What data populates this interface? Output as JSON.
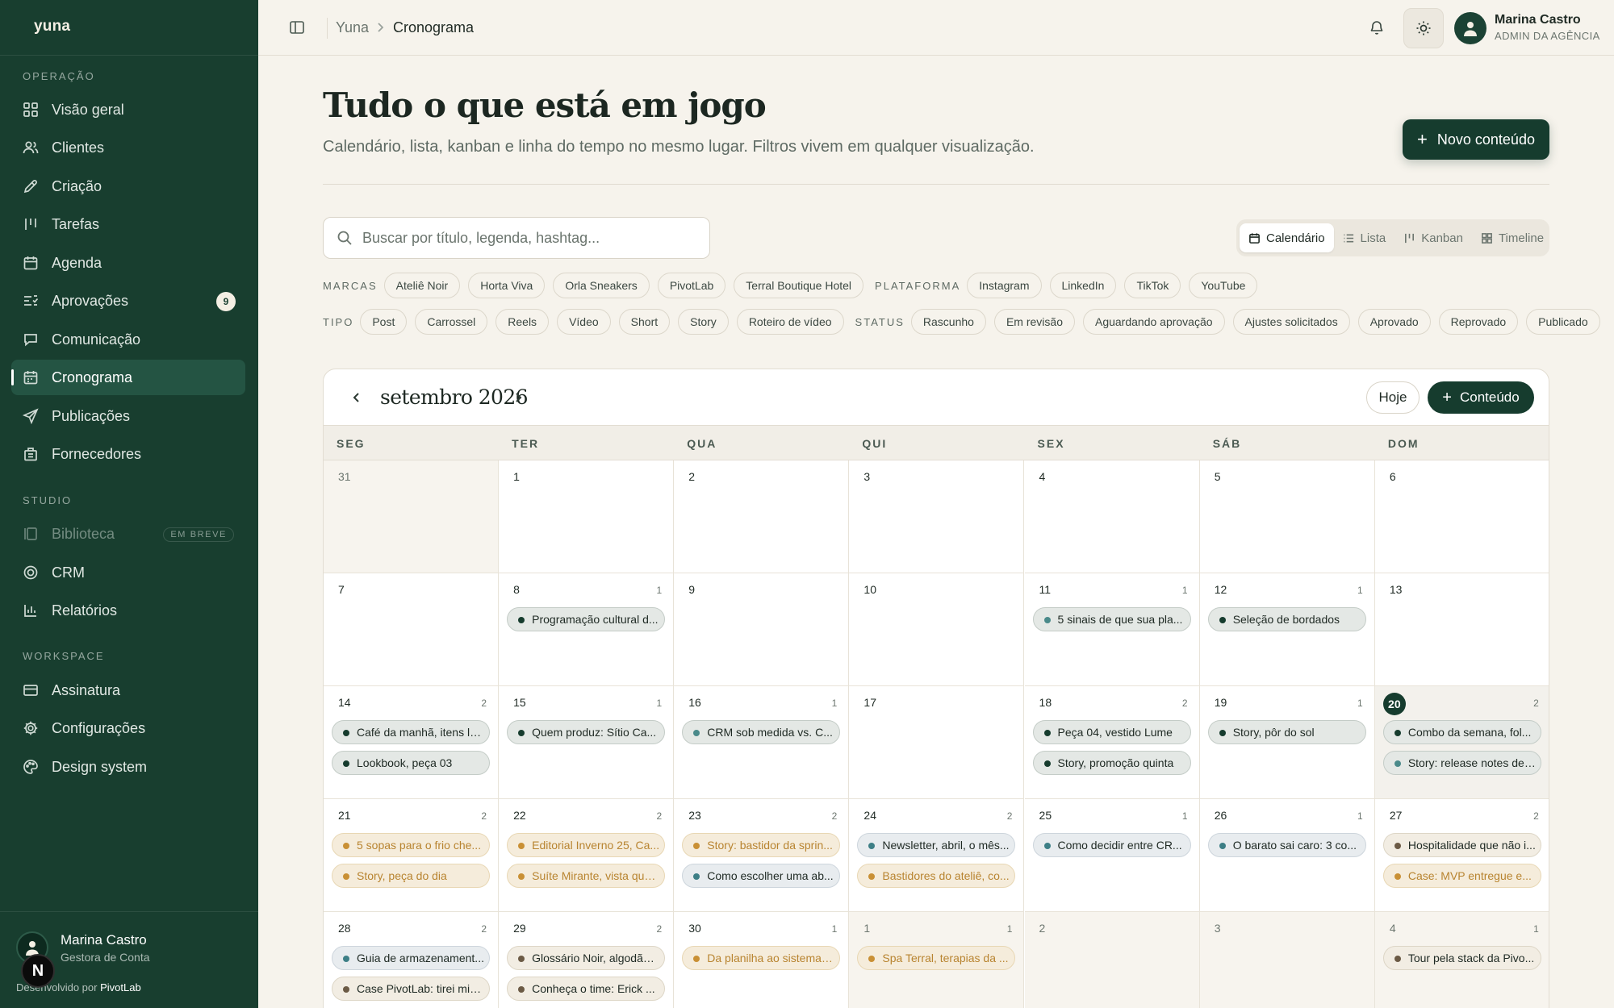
{
  "app": {
    "logo": "yuna"
  },
  "sidebar": {
    "sections": [
      {
        "label": "OPERAÇÃO",
        "items": [
          {
            "label": "Visão geral",
            "icon": "grid-icon"
          },
          {
            "label": "Clientes",
            "icon": "users-icon"
          },
          {
            "label": "Criação",
            "icon": "pen-icon"
          },
          {
            "label": "Tarefas",
            "icon": "kanban-icon"
          },
          {
            "label": "Agenda",
            "icon": "calendar-icon"
          },
          {
            "label": "Aprovações",
            "icon": "list-check-icon",
            "badge": "9"
          },
          {
            "label": "Comunicação",
            "icon": "chat-icon"
          },
          {
            "label": "Cronograma",
            "icon": "calendar-icon",
            "active": true
          },
          {
            "label": "Publicações",
            "icon": "send-icon"
          },
          {
            "label": "Fornecedores",
            "icon": "building-icon"
          }
        ]
      },
      {
        "label": "STUDIO",
        "items": [
          {
            "label": "Biblioteca",
            "icon": "library-icon",
            "soon": "EM BREVE"
          },
          {
            "label": "CRM",
            "icon": "target-icon"
          },
          {
            "label": "Relatórios",
            "icon": "bar-chart-icon"
          }
        ]
      },
      {
        "label": "WORKSPACE",
        "items": [
          {
            "label": "Assinatura",
            "icon": "card-icon"
          },
          {
            "label": "Configurações",
            "icon": "gear-icon"
          },
          {
            "label": "Design system",
            "icon": "palette-icon"
          }
        ]
      }
    ],
    "user": {
      "name": "Marina Castro",
      "role": "Gestora de Conta"
    },
    "credit": {
      "prefix": "Desenvolvido por",
      "brand": "PivotLab"
    },
    "assistant_initial": "N"
  },
  "topbar": {
    "breadcrumb": {
      "root": "Yuna",
      "current": "Cronograma"
    },
    "user": {
      "name": "Marina Castro",
      "role": "ADMIN DA AGÊNCIA"
    }
  },
  "header": {
    "title": "Tudo o que está em jogo",
    "subtitle": "Calendário, lista, kanban e linha do tempo no mesmo lugar. Filtros vivem em qualquer visualização.",
    "new_button": "Novo conteúdo"
  },
  "search": {
    "placeholder": "Buscar por título, legenda, hashtag..."
  },
  "views": [
    {
      "label": "Calendário",
      "icon": "calendar-icon",
      "active": true
    },
    {
      "label": "Lista",
      "icon": "list-icon"
    },
    {
      "label": "Kanban",
      "icon": "kanban-icon"
    },
    {
      "label": "Timeline",
      "icon": "grid-icon"
    }
  ],
  "filters": {
    "marcas": {
      "label": "MARCAS",
      "options": [
        "Ateliê Noir",
        "Horta Viva",
        "Orla Sneakers",
        "PivotLab",
        "Terral Boutique Hotel"
      ]
    },
    "plataforma": {
      "label": "PLATAFORMA",
      "options": [
        "Instagram",
        "LinkedIn",
        "TikTok",
        "YouTube"
      ]
    },
    "tipo": {
      "label": "TIPO",
      "options": [
        "Post",
        "Carrossel",
        "Reels",
        "Vídeo",
        "Short",
        "Story",
        "Roteiro de vídeo"
      ]
    },
    "status": {
      "label": "STATUS",
      "options": [
        "Rascunho",
        "Em revisão",
        "Aguardando aprovação",
        "Ajustes solicitados",
        "Aprovado",
        "Reprovado",
        "Publicado"
      ]
    }
  },
  "calendar": {
    "month_label": "setembro 2026",
    "today_button": "Hoje",
    "add_button": "Conteúdo",
    "weekdays": [
      "SEG",
      "TER",
      "QUA",
      "QUI",
      "SEX",
      "SÁB",
      "DOM"
    ],
    "colors": {
      "primary": "#163c2e",
      "accent": "#c99035",
      "teal": "#4a8a8a"
    },
    "weeks": [
      [
        {
          "day": "31",
          "out": true,
          "events": []
        },
        {
          "day": "1",
          "events": []
        },
        {
          "day": "2",
          "events": []
        },
        {
          "day": "3",
          "events": []
        },
        {
          "day": "4",
          "events": []
        },
        {
          "day": "5",
          "events": []
        },
        {
          "day": "6",
          "events": []
        }
      ],
      [
        {
          "day": "7",
          "events": []
        },
        {
          "day": "8",
          "count": "1",
          "events": [
            {
              "title": "Programação cultural d...",
              "style": "g"
            }
          ]
        },
        {
          "day": "9",
          "events": []
        },
        {
          "day": "10",
          "events": []
        },
        {
          "day": "11",
          "count": "1",
          "events": [
            {
              "title": "5 sinais de que sua pla...",
              "style": "t"
            }
          ]
        },
        {
          "day": "12",
          "count": "1",
          "events": [
            {
              "title": "Seleção de bordados",
              "style": "g"
            }
          ]
        },
        {
          "day": "13",
          "events": []
        }
      ],
      [
        {
          "day": "14",
          "count": "2",
          "events": [
            {
              "title": "Café da manhã, itens lo...",
              "style": "g"
            },
            {
              "title": "Lookbook, peça 03",
              "style": "g"
            }
          ]
        },
        {
          "day": "15",
          "count": "1",
          "events": [
            {
              "title": "Quem produz: Sítio Ca...",
              "style": "g"
            }
          ]
        },
        {
          "day": "16",
          "count": "1",
          "events": [
            {
              "title": "CRM sob medida vs. C...",
              "style": "t"
            }
          ]
        },
        {
          "day": "17",
          "events": []
        },
        {
          "day": "18",
          "count": "2",
          "events": [
            {
              "title": "Peça 04, vestido Lume",
              "style": "g"
            },
            {
              "title": "Story, promoção quinta",
              "style": "g"
            }
          ]
        },
        {
          "day": "19",
          "count": "1",
          "events": [
            {
              "title": "Story, pôr do sol",
              "style": "g"
            }
          ]
        },
        {
          "day": "20",
          "count": "2",
          "today": true,
          "events": [
            {
              "title": "Combo da semana, fol...",
              "style": "g"
            },
            {
              "title": "Story: release notes de ...",
              "style": "t"
            }
          ]
        }
      ],
      [
        {
          "day": "21",
          "count": "2",
          "events": [
            {
              "title": "5 sopas para o frio che...",
              "style": "o"
            },
            {
              "title": "Story, peça do dia",
              "style": "o"
            }
          ]
        },
        {
          "day": "22",
          "count": "2",
          "events": [
            {
              "title": "Editorial Inverno 25, Ca...",
              "style": "o"
            },
            {
              "title": "Suíte Mirante, vista que...",
              "style": "o"
            }
          ]
        },
        {
          "day": "23",
          "count": "2",
          "events": [
            {
              "title": "Story: bastidor da sprin...",
              "style": "o"
            },
            {
              "title": "Como escolher uma ab...",
              "style": "b"
            }
          ]
        },
        {
          "day": "24",
          "count": "2",
          "events": [
            {
              "title": "Newsletter, abril, o mês...",
              "style": "b"
            },
            {
              "title": "Bastidores do ateliê, co...",
              "style": "o"
            }
          ]
        },
        {
          "day": "25",
          "count": "1",
          "events": [
            {
              "title": "Como decidir entre CR...",
              "style": "b"
            }
          ]
        },
        {
          "day": "26",
          "count": "1",
          "events": [
            {
              "title": "O barato sai caro: 3 co...",
              "style": "b"
            }
          ]
        },
        {
          "day": "27",
          "count": "2",
          "events": [
            {
              "title": "Hospitalidade que não i...",
              "style": "go"
            },
            {
              "title": "Case: MVP entregue e...",
              "style": "o"
            }
          ]
        }
      ],
      [
        {
          "day": "28",
          "count": "2",
          "events": [
            {
              "title": "Guia de armazenament...",
              "style": "b"
            },
            {
              "title": "Case PivotLab: tirei min...",
              "style": "go"
            }
          ]
        },
        {
          "day": "29",
          "count": "2",
          "events": [
            {
              "title": "Glossário Noir, algodão ...",
              "style": "go"
            },
            {
              "title": "Conheça o time: Erick ...",
              "style": "go"
            }
          ]
        },
        {
          "day": "30",
          "count": "1",
          "events": [
            {
              "title": "Da planilha ao sistema: ...",
              "style": "o"
            }
          ]
        },
        {
          "day": "1",
          "count": "1",
          "out": true,
          "events": [
            {
              "title": "Spa Terral, terapias da ...",
              "style": "o"
            }
          ]
        },
        {
          "day": "2",
          "out": true,
          "events": []
        },
        {
          "day": "3",
          "out": true,
          "events": []
        },
        {
          "day": "4",
          "count": "1",
          "out": true,
          "events": [
            {
              "title": "Tour pela stack da Pivo...",
              "style": "go"
            }
          ]
        }
      ]
    ]
  }
}
